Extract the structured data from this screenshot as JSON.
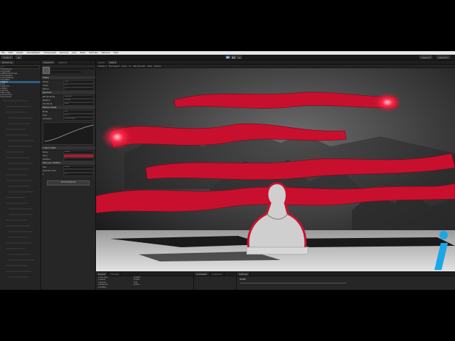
{
  "menu": [
    "File",
    "Edit",
    "Assets",
    "GameObject",
    "Component",
    "Services",
    "Jobs",
    "Build",
    "Tutorials",
    "Window",
    "Help"
  ],
  "toolbar": {
    "account_label": "Unity ▾",
    "cloud_label": "☁",
    "right_items": [
      "Layers ▾",
      "Layout ▾"
    ]
  },
  "hierarchy": {
    "tab": "Hierarchy",
    "search_placeholder": "All",
    "rows": [
      "▾ ShardScene*",
      "  ▸ SampleRig",
      "  ▸ HDRP Post Process",
      "  ▸ EventSystem",
      "  ▸ SceneSettings",
      "  ▾ Fire Effect",
      "    ▸ Particle",
      "    ▸ Trail",
      "    ▸ Distortion",
      "  ▸ Statue",
      "  ▸ Camera",
      "  ▸ Main Light",
      "  ▸ Environment",
      "  ▸ Fog Volume"
    ]
  },
  "inspector": {
    "tab": "Inspector",
    "tab2": "Lighting",
    "sections": [
      {
        "header": "Shape",
        "rows": [
          [
            "Shape",
            "Cone"
          ],
          [
            "Angle",
            "25"
          ],
          [
            "Radius",
            "1"
          ]
        ]
      },
      {
        "header": "Renderer",
        "rows": [
          [
            "Render Mode",
            "Billboard"
          ],
          [
            "Material",
            "FireMat"
          ],
          [
            "Sort Mode",
            "None"
          ]
        ]
      },
      {
        "header": "Texture Sheet",
        "rows": [
          [
            "Mode",
            "Grid"
          ],
          [
            "Tiles",
            "4 x 4"
          ],
          [
            "Animation",
            "Whole Sheet"
          ]
        ]
      },
      {
        "header": "Custom Data",
        "rows": [
          [
            "Mode",
            "Vector"
          ],
          [
            "Color",
            ""
          ],
          [
            "Lifetime",
            "5"
          ]
        ]
      },
      {
        "header": "Size over Lifetime",
        "rows": [
          [
            "Size",
            "Curve"
          ],
          [
            "Separate Axes",
            ""
          ],
          [
            "X",
            "0.5"
          ]
        ]
      }
    ],
    "add_component": "Add Component"
  },
  "scene_view": {
    "tabs": [
      {
        "label": "Scene",
        "active": false
      },
      {
        "label": "Game",
        "active": true
      }
    ],
    "toolbar_items": [
      "Display 1",
      "Free Aspect",
      "Scale",
      "1x",
      "Play Focused",
      "Stats",
      "Gizmos"
    ],
    "colors": {
      "fire": "#c8102e",
      "fire_glow": "#ff2a4a",
      "background": "#3a3a3a",
      "floor": "#d8d8d8"
    }
  },
  "bottom": {
    "tabs": [
      "Project",
      "Console",
      "Animation"
    ],
    "tabs2": [
      "Inspector",
      "Settings"
    ],
    "project_tree": [
      "▸ Favorites",
      "▾ Assets",
      "  ▸ Scenes",
      "  ▸ Materials",
      "  ▸ Prefabs",
      "▸ Packages"
    ],
    "files": [
      "FireMat",
      "FireTex",
      "Trail",
      "Statue"
    ],
    "hdrp_title": "HDRP"
  },
  "brand_logo": "i-icon"
}
